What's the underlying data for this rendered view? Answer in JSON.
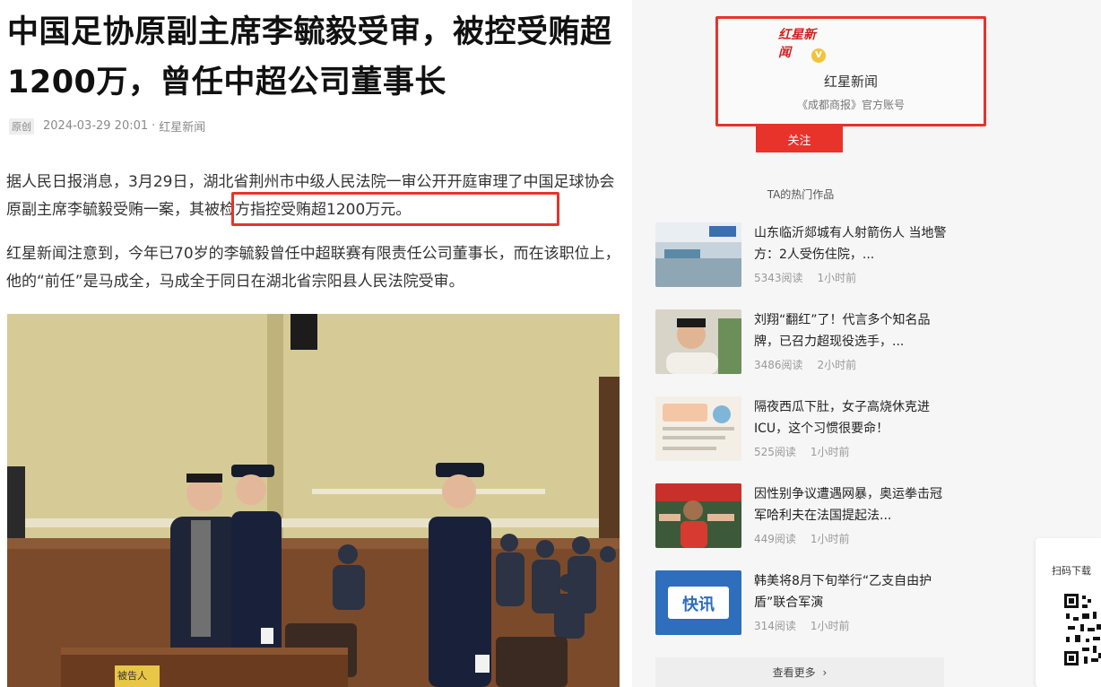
{
  "article": {
    "title": "中国足协原副主席李毓毅受审，被控受贿超1200万，曾任中超公司董事长",
    "meta": {
      "original_tag": "原创",
      "datetime": "2024-03-29 20:01",
      "separator": "·",
      "source": "红星新闻"
    },
    "paragraphs": [
      "据人民日报消息，3月29日，湖北省荆州市中级人民法院一审公开开庭审理了中国足球协会原副主席李毓毅受贿一案，其被检方指控受贿超1200万元。",
      "红星新闻注意到，今年已70岁的李毓毅曾任中超联赛有限责任公司董事长，而在该职位上，他的“前任”是马成全，马成全于同日在湖北省宗阳县人民法院受审。"
    ],
    "photo_sign": "被告人"
  },
  "author": {
    "logo_text": "红星新闻",
    "verified": "V",
    "name": "红星新闻",
    "description": "《成都商报》官方账号",
    "follow_label": "关注"
  },
  "hot": {
    "title": "TA的热门作品",
    "items": [
      {
        "title": "山东临沂郯城有人射箭伤人 当地警方：2人受伤住院，...",
        "reads": "5343阅读",
        "time": "1小时前"
      },
      {
        "title": "刘翔“翻红”了！代言多个知名品牌，已召力超现役选手，...",
        "reads": "3486阅读",
        "time": "2小时前"
      },
      {
        "title": "隔夜西瓜下肚，女子高烧休克进ICU，这个习惯很要命！",
        "reads": "525阅读",
        "time": "1小时前"
      },
      {
        "title": "因性别争议遭遇网暴，奥运拳击冠军哈利夫在法国提起法...",
        "reads": "449阅读",
        "time": "1小时前"
      },
      {
        "title": "韩美将8月下旬举行“乙支自由护盾”联合军演",
        "reads": "314阅读",
        "time": "1小时前",
        "thumb_text": "快讯"
      }
    ],
    "more_label": "查看更多",
    "more_arrow": "›"
  },
  "qr": {
    "label": "扫码下载"
  },
  "colors": {
    "accent": "#e8332a",
    "link_bg": "#eeeeee"
  }
}
